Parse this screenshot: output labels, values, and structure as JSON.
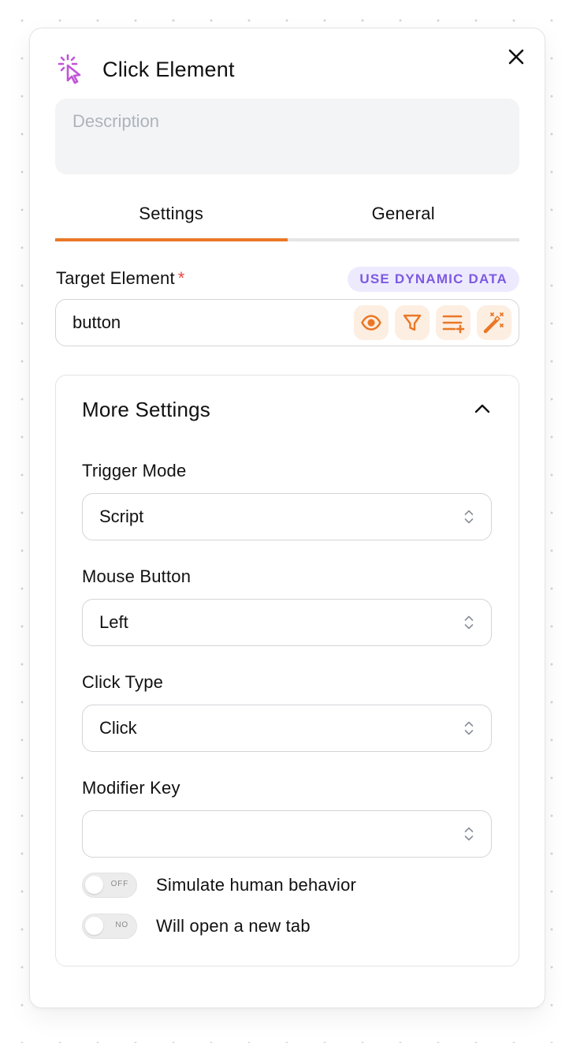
{
  "header": {
    "title": "Click Element",
    "icon": "click-cursor-icon",
    "close_icon": "close-icon"
  },
  "description": {
    "value": "",
    "placeholder": "Description"
  },
  "tabs": [
    {
      "label": "Settings",
      "active": true
    },
    {
      "label": "General",
      "active": false
    }
  ],
  "target_element": {
    "label": "Target Element",
    "required_mark": "*",
    "dynamic_data_label": "USE DYNAMIC DATA",
    "value": "button",
    "actions": [
      {
        "name": "preview",
        "icon": "eye-icon"
      },
      {
        "name": "filter",
        "icon": "filter-icon"
      },
      {
        "name": "add-to-list",
        "icon": "list-plus-icon"
      },
      {
        "name": "magic-pick",
        "icon": "magic-wand-icon"
      }
    ]
  },
  "more_settings": {
    "title": "More Settings",
    "expanded": true,
    "fields": [
      {
        "label": "Trigger Mode",
        "value": "Script"
      },
      {
        "label": "Mouse Button",
        "value": "Left"
      },
      {
        "label": "Click Type",
        "value": "Click"
      },
      {
        "label": "Modifier Key",
        "value": ""
      }
    ],
    "toggles": [
      {
        "label": "Simulate human behavior",
        "state_text": "OFF",
        "on": false
      },
      {
        "label": "Will open a new tab",
        "state_text": "NO",
        "on": false
      }
    ]
  },
  "colors": {
    "accent": "#ea7726",
    "accent_bg": "#fdeee2",
    "dynamic_badge_text": "#7c5ae0",
    "dynamic_badge_bg": "#eeeafe",
    "icon_purple": "#c054d8",
    "required": "#ef4444"
  }
}
